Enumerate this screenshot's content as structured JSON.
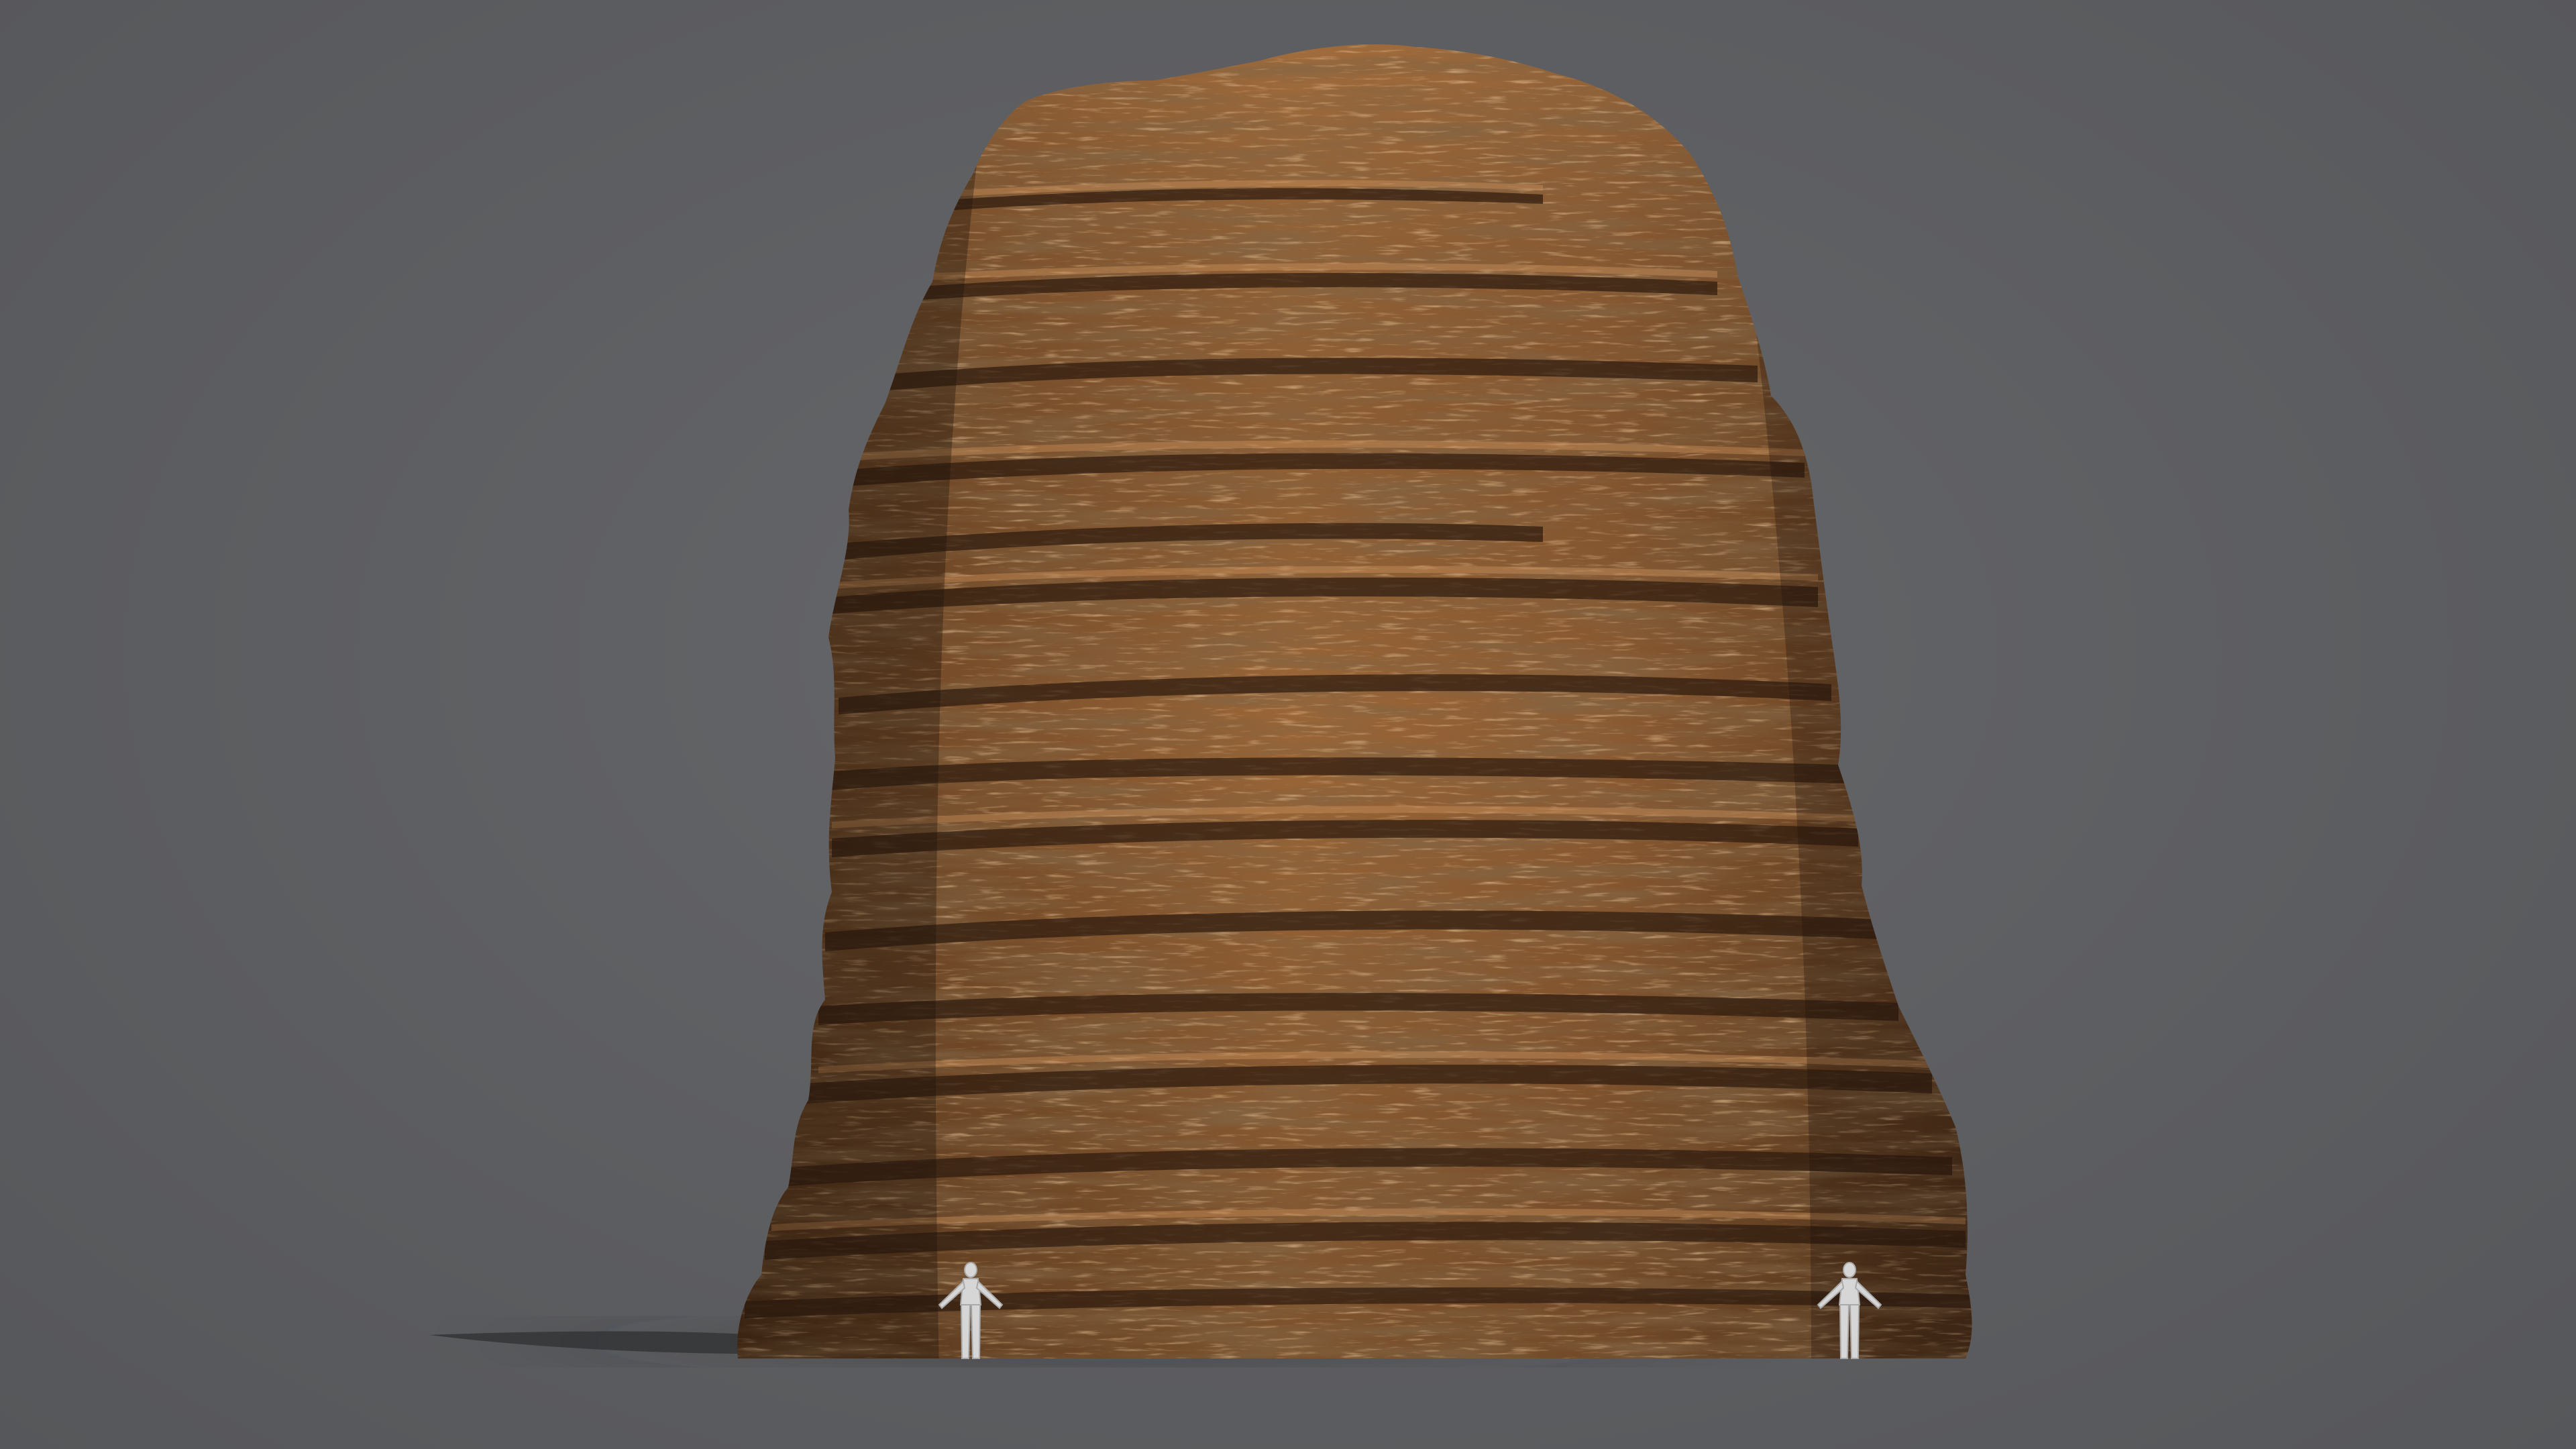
{
  "scene": {
    "background_color": "#5d5e60",
    "subject": "layered-sandstone-rock-formation",
    "rock_base_color": "#8a5a30",
    "rock_highlight_color": "#c88a52",
    "rock_shadow_color": "#3a2414",
    "mannequin_color": "#d8d8d8",
    "mannequin_count": 2
  }
}
